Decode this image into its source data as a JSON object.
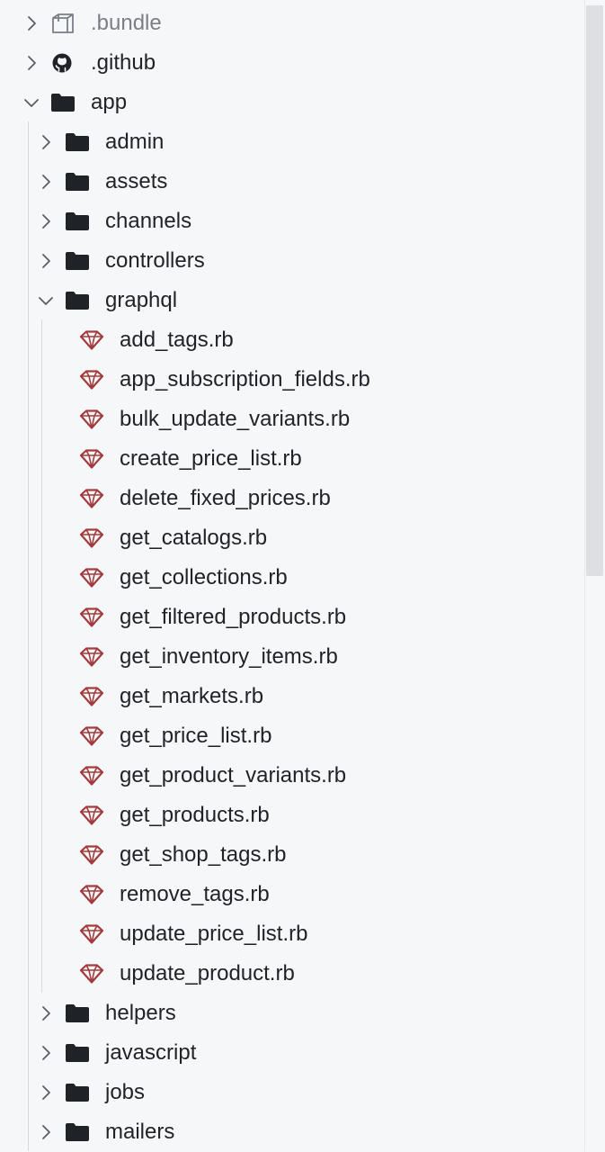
{
  "tree": {
    "items": [
      {
        "label": ".bundle",
        "kind": "folder",
        "icon": "package-icon",
        "expanded": false,
        "dim": true
      },
      {
        "label": ".github",
        "kind": "folder",
        "icon": "github-icon",
        "expanded": false
      },
      {
        "label": "app",
        "kind": "folder",
        "icon": "folder-icon",
        "expanded": true
      },
      {
        "label": "admin",
        "kind": "folder",
        "icon": "folder-icon",
        "expanded": false
      },
      {
        "label": "assets",
        "kind": "folder",
        "icon": "folder-icon",
        "expanded": false
      },
      {
        "label": "channels",
        "kind": "folder",
        "icon": "folder-icon",
        "expanded": false
      },
      {
        "label": "controllers",
        "kind": "folder",
        "icon": "folder-icon",
        "expanded": false
      },
      {
        "label": "graphql",
        "kind": "folder",
        "icon": "folder-icon",
        "expanded": true
      },
      {
        "label": "add_tags.rb",
        "kind": "file",
        "icon": "ruby-icon"
      },
      {
        "label": "app_subscription_fields.rb",
        "kind": "file",
        "icon": "ruby-icon"
      },
      {
        "label": "bulk_update_variants.rb",
        "kind": "file",
        "icon": "ruby-icon"
      },
      {
        "label": "create_price_list.rb",
        "kind": "file",
        "icon": "ruby-icon"
      },
      {
        "label": "delete_fixed_prices.rb",
        "kind": "file",
        "icon": "ruby-icon"
      },
      {
        "label": "get_catalogs.rb",
        "kind": "file",
        "icon": "ruby-icon"
      },
      {
        "label": "get_collections.rb",
        "kind": "file",
        "icon": "ruby-icon"
      },
      {
        "label": "get_filtered_products.rb",
        "kind": "file",
        "icon": "ruby-icon"
      },
      {
        "label": "get_inventory_items.rb",
        "kind": "file",
        "icon": "ruby-icon"
      },
      {
        "label": "get_markets.rb",
        "kind": "file",
        "icon": "ruby-icon"
      },
      {
        "label": "get_price_list.rb",
        "kind": "file",
        "icon": "ruby-icon"
      },
      {
        "label": "get_product_variants.rb",
        "kind": "file",
        "icon": "ruby-icon"
      },
      {
        "label": "get_products.rb",
        "kind": "file",
        "icon": "ruby-icon"
      },
      {
        "label": "get_shop_tags.rb",
        "kind": "file",
        "icon": "ruby-icon"
      },
      {
        "label": "remove_tags.rb",
        "kind": "file",
        "icon": "ruby-icon"
      },
      {
        "label": "update_price_list.rb",
        "kind": "file",
        "icon": "ruby-icon"
      },
      {
        "label": "update_product.rb",
        "kind": "file",
        "icon": "ruby-icon"
      },
      {
        "label": "helpers",
        "kind": "folder",
        "icon": "folder-icon",
        "expanded": false
      },
      {
        "label": "javascript",
        "kind": "folder",
        "icon": "folder-icon",
        "expanded": false
      },
      {
        "label": "jobs",
        "kind": "folder",
        "icon": "folder-icon",
        "expanded": false
      },
      {
        "label": "mailers",
        "kind": "folder",
        "icon": "folder-icon",
        "expanded": false
      }
    ]
  },
  "colors": {
    "background": "#f6f7f9",
    "text": "#1f2328",
    "dim_text": "#7a7f86",
    "folder": "#1f2328",
    "ruby": "#a23b3b",
    "guide": "#d6d8db",
    "scrollbar_thumb": "#dddfe3"
  }
}
